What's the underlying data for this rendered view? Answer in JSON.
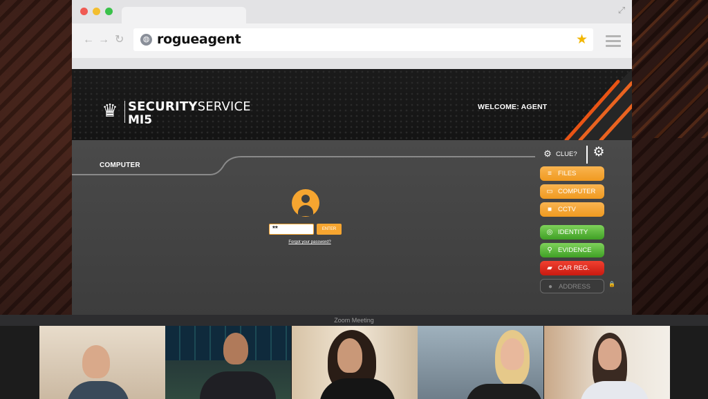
{
  "browser": {
    "url": "rogueagent"
  },
  "site": {
    "logo_line1_bold": "SECURITY",
    "logo_line1_rest": "SERVICE",
    "logo_line2": "MI5",
    "welcome": "WELCOME: AGENT",
    "page_title": "COMPUTER",
    "password_value": "**",
    "enter_label": "ENTER",
    "forgot_label": "Forgot your password?",
    "clue_label": "CLUE?",
    "nav": [
      {
        "label": "FILES",
        "icon": "files-icon",
        "color": "orange"
      },
      {
        "label": "COMPUTER",
        "icon": "computer-icon",
        "color": "orange"
      },
      {
        "label": "CCTV",
        "icon": "camera-icon",
        "color": "orange"
      },
      {
        "label": "IDENTITY",
        "icon": "fingerprint-icon",
        "color": "green"
      },
      {
        "label": "EVIDENCE",
        "icon": "magnifier-icon",
        "color": "green"
      },
      {
        "label": "CAR REG.",
        "icon": "car-icon",
        "color": "red"
      },
      {
        "label": "ADDRESS",
        "icon": "map-pin-icon",
        "color": "disabled"
      }
    ],
    "accent_color": "#f6a530"
  },
  "zoom": {
    "title": "Zoom Meeting",
    "participants": 5
  }
}
